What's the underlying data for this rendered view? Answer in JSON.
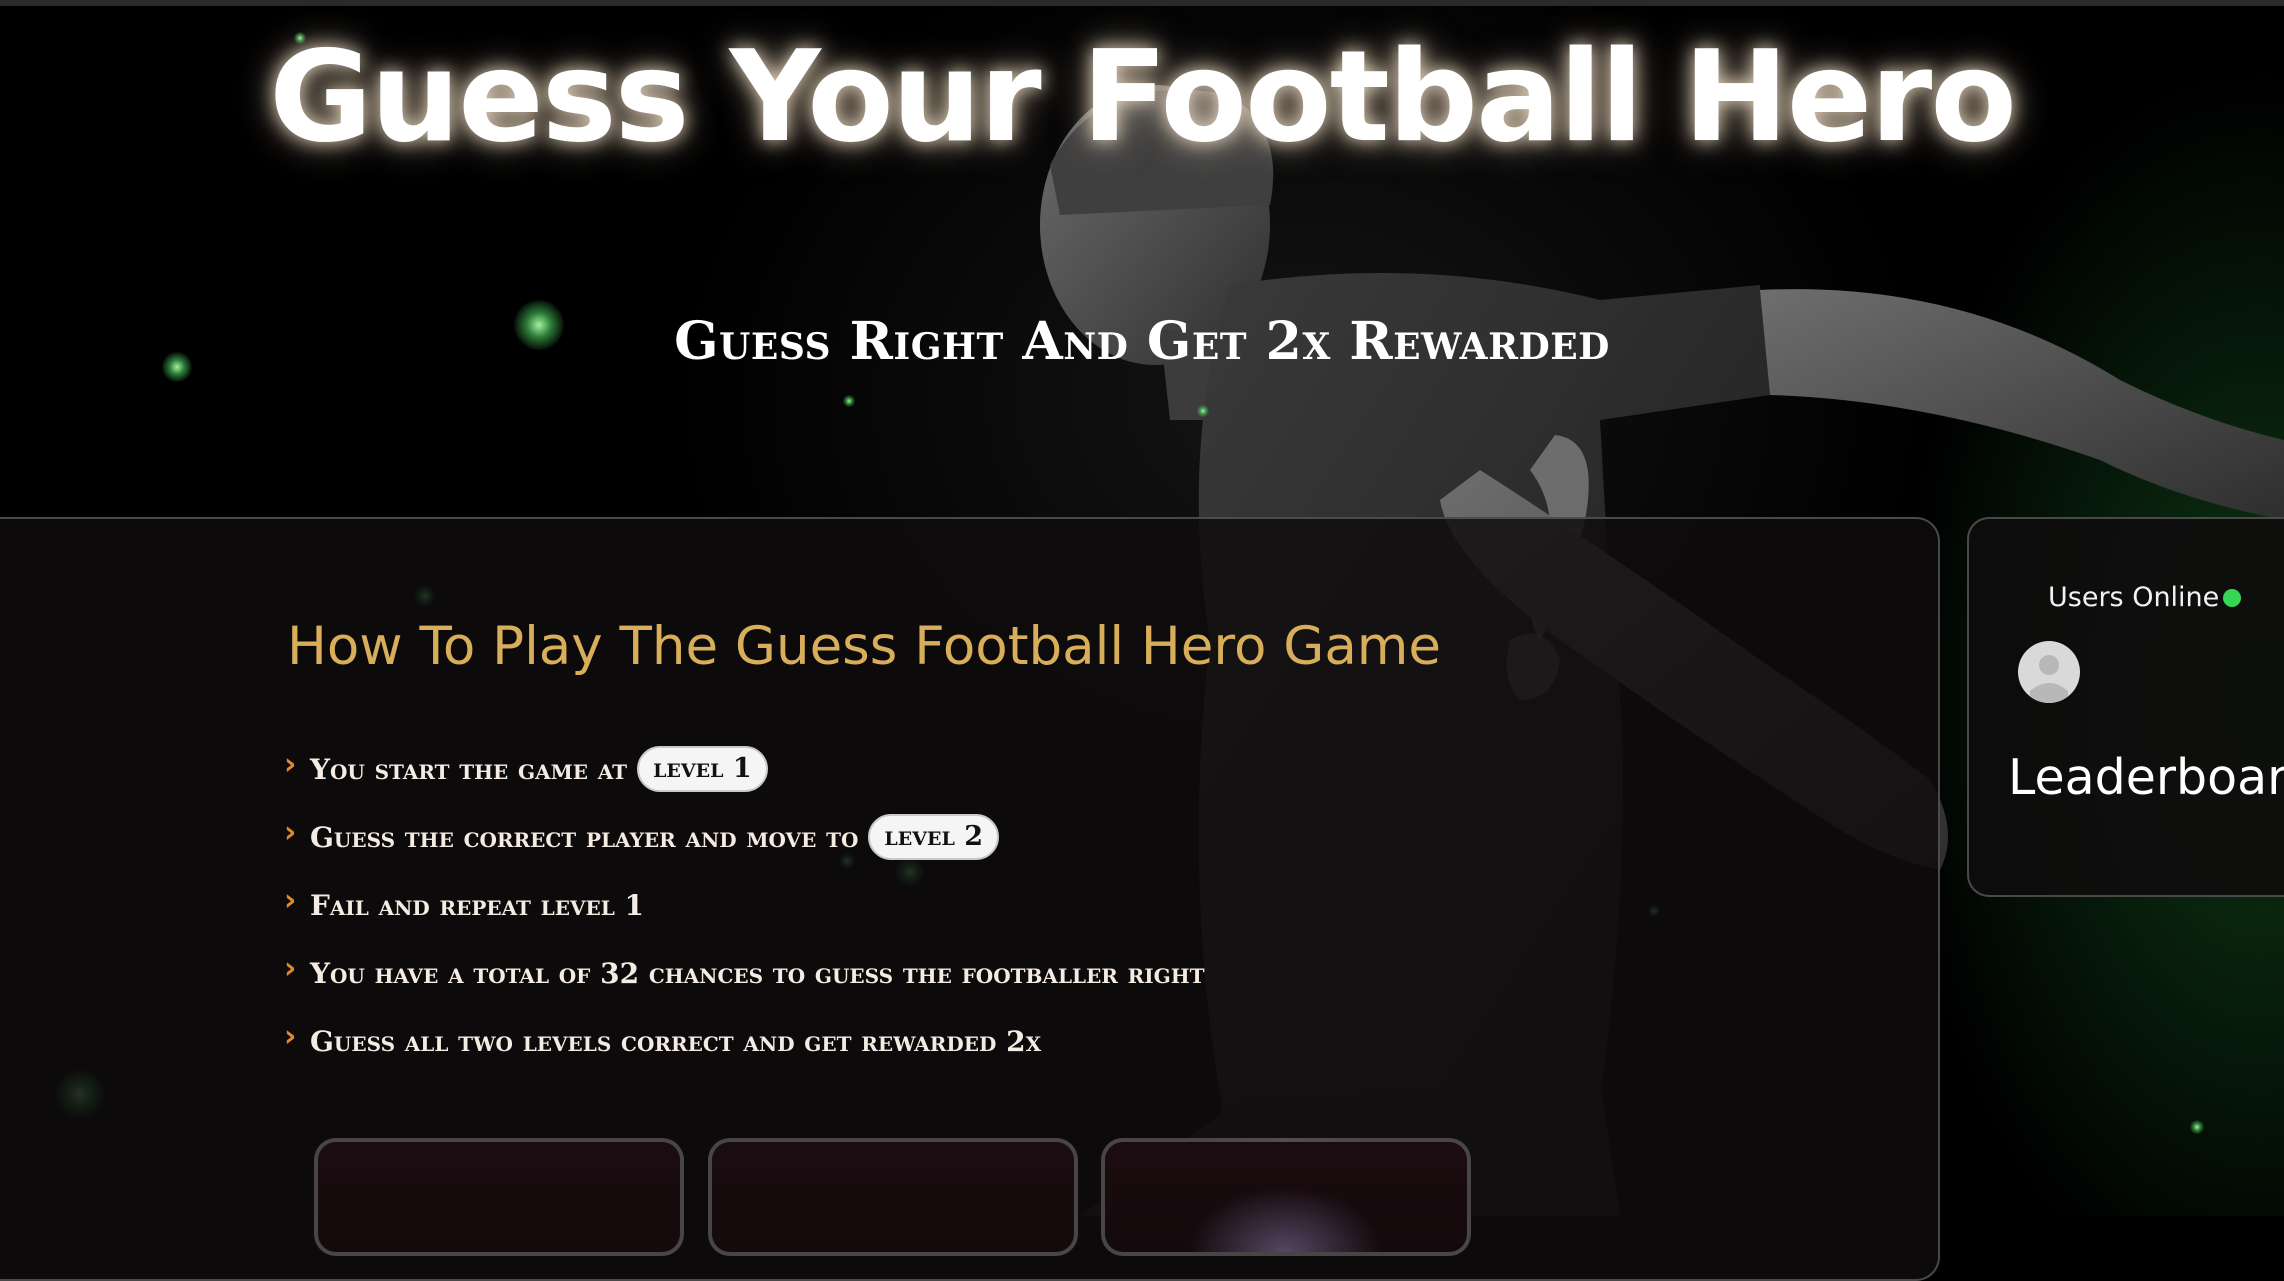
{
  "hero": {
    "title": "Guess Your Football Hero",
    "subtitle": "Guess Right And Get 2x Rewarded"
  },
  "how_to_play": {
    "title": "How To Play The Guess Football Hero Game",
    "rules": [
      {
        "text": "You start the game at",
        "badge": "level 1"
      },
      {
        "text": "Guess the correct player and move to",
        "badge": "level 2"
      },
      {
        "text": "Fail and repeat level 1"
      },
      {
        "text": "You have a total of 32 chances to guess the footballer right"
      },
      {
        "text": "Guess all two levels correct and get rewarded 2x"
      }
    ]
  },
  "sidebar": {
    "users_online": "Users Online",
    "leaderboard_title": "Leaderboar"
  },
  "colors": {
    "accent_gold": "#d9ae5a",
    "chevron_orange": "#e08a2c",
    "online_green": "#37d657"
  }
}
